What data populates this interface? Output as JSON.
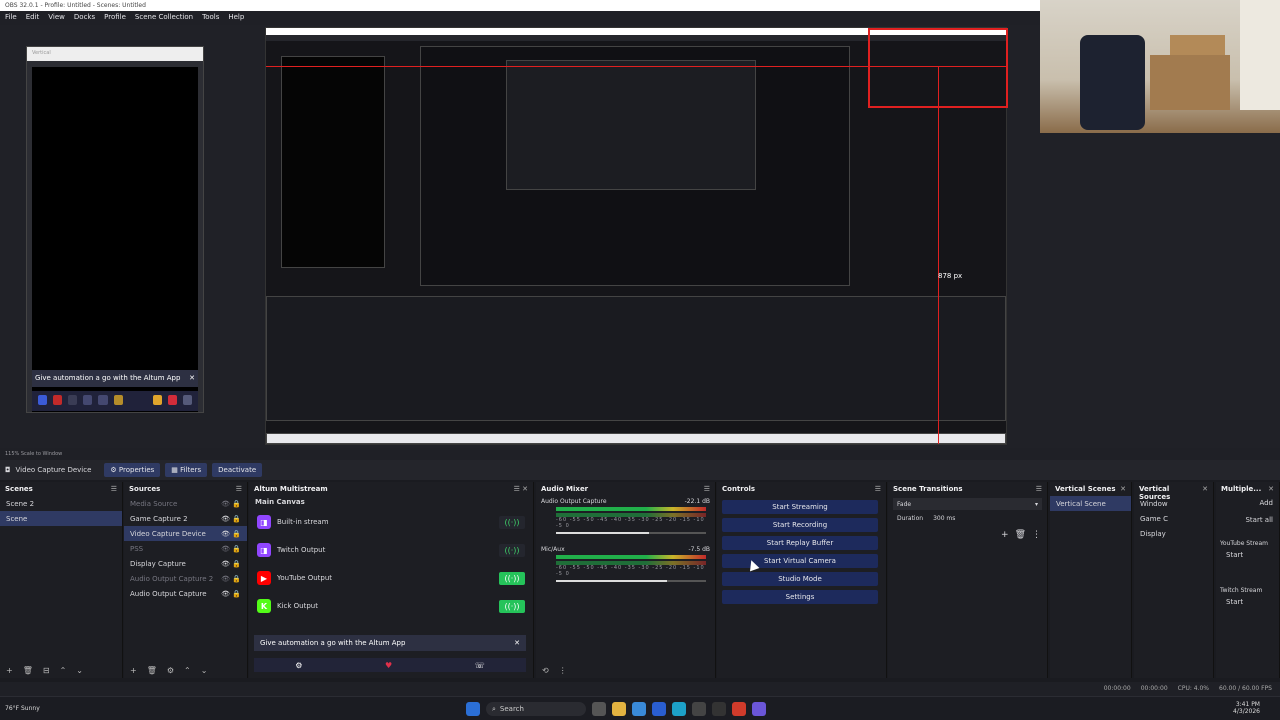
{
  "window": {
    "title": "OBS 32.0.1 - Profile: Untitled - Scenes: Untitled"
  },
  "menu": [
    "File",
    "Edit",
    "View",
    "Docks",
    "Profile",
    "Scene Collection",
    "Tools",
    "Help"
  ],
  "vertical_preview": {
    "header": "Vertical",
    "banner_text": "Give automation a go with the Altum App",
    "banner_close": "✕"
  },
  "canvas": {
    "measure_label": "878 px"
  },
  "zoom": {
    "text": "115%   Scale to Window"
  },
  "source_toolbar": {
    "source_name": "Video Capture Device",
    "properties": "Properties",
    "filters": "Filters",
    "deactivate": "Deactivate"
  },
  "scenes": {
    "title": "Scenes",
    "items": [
      {
        "label": "Scene 2",
        "selected": false
      },
      {
        "label": "Scene",
        "selected": true
      }
    ]
  },
  "sources": {
    "title": "Sources",
    "items": [
      {
        "label": "Media Source",
        "dim": true,
        "selected": false
      },
      {
        "label": "Game Capture 2",
        "dim": false,
        "selected": false
      },
      {
        "label": "Video Capture Device",
        "dim": false,
        "selected": true
      },
      {
        "label": "PSS",
        "dim": true,
        "selected": false
      },
      {
        "label": "Display Capture",
        "dim": false,
        "selected": false
      },
      {
        "label": "Audio Output Capture 2",
        "dim": true,
        "selected": false
      },
      {
        "label": "Audio Output Capture",
        "dim": false,
        "selected": false
      }
    ]
  },
  "multistream": {
    "title": "Altum Multistream",
    "canvas_label": "Main Canvas",
    "outputs": [
      {
        "label": "Built-in stream",
        "icon": "twitch-icon",
        "color": "#9146ff",
        "on": false
      },
      {
        "label": "Twitch Output",
        "icon": "twitch-icon",
        "color": "#9146ff",
        "on": false
      },
      {
        "label": "YouTube Output",
        "icon": "youtube-icon",
        "color": "#ff0000",
        "on": true
      },
      {
        "label": "Kick Output",
        "icon": "kick-icon",
        "color": "#53fc18",
        "on": true
      }
    ],
    "banner": "Give automation a go with the Altum App",
    "banner_close": "✕"
  },
  "mixer": {
    "title": "Audio Mixer",
    "tracks": [
      {
        "name": "Audio Output Capture",
        "db": "-22.1 dB",
        "level": 0.62
      },
      {
        "name": "Mic/Aux",
        "db": "-7.5 dB",
        "level": 0.74
      }
    ],
    "ticks": "-60 -55 -50 -45 -40 -35 -30 -25 -20 -15 -10 -5 0"
  },
  "controls": {
    "title": "Controls",
    "buttons": [
      "Start Streaming",
      "Start Recording",
      "Start Replay Buffer",
      "Start Virtual Camera",
      "Studio Mode",
      "Settings"
    ]
  },
  "transitions": {
    "title": "Scene Transitions",
    "type": "Fade",
    "duration_label": "Duration",
    "duration_value": "300 ms"
  },
  "vertical_scenes": {
    "title": "Vertical Scenes",
    "items": [
      "Vertical Scene"
    ]
  },
  "vertical_sources": {
    "title": "Vertical Sources",
    "items": [
      "Window",
      "Game C",
      "Display"
    ]
  },
  "multiple": {
    "title": "Multiple...",
    "add": "Add",
    "start_all": "Start all",
    "youtube": "YouTube Stream",
    "twitch": "Twitch Stream",
    "start": "Start"
  },
  "status": {
    "time1": "00:00:00",
    "time2": "00:00:00",
    "cpu": "CPU: 4.0%",
    "fps": "60.00 / 60.00 FPS"
  },
  "taskbar": {
    "weather": "76°F Sunny",
    "search": "Search",
    "clock": "3:41 PM",
    "date": "4/3/2026"
  }
}
